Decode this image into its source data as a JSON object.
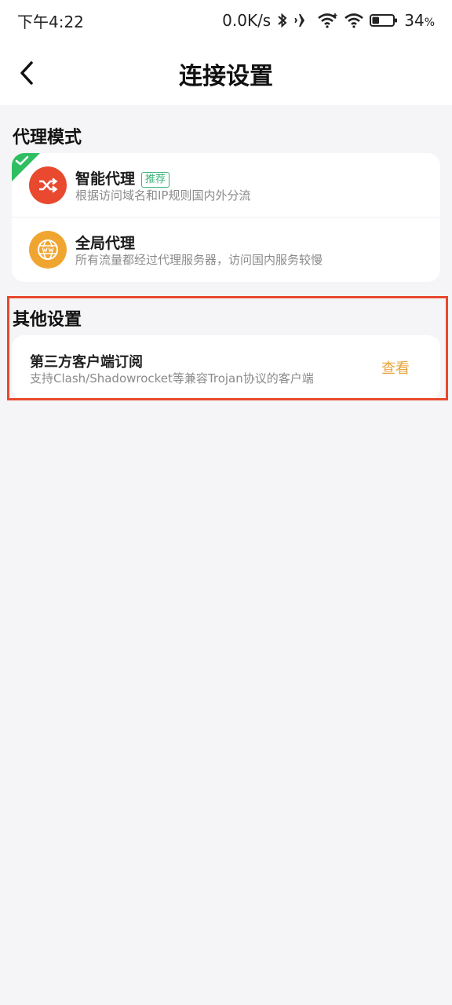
{
  "status_bar": {
    "time": "下午4:22",
    "net_speed": "0.0K/s",
    "battery": "34",
    "battery_unit": "%",
    "battery_level": 0.34,
    "icons": [
      "bluetooth-icon",
      "airplane-mode-icon",
      "wifi-icon",
      "wifi-icon",
      "battery-icon"
    ]
  },
  "header": {
    "title": "连接设置",
    "back_icon": "chevron-left-icon"
  },
  "proxy_mode": {
    "section_title": "代理模式",
    "selected_index": 0,
    "options": [
      {
        "name": "智能代理",
        "badge": "推荐",
        "desc": "根据访问域名和IP规则国内外分流",
        "icon": "shuffle-icon",
        "icon_color": "#e8492f"
      },
      {
        "name": "全局代理",
        "desc": "所有流量都经过代理服务器，访问国内服务较慢",
        "icon": "globe-www-icon",
        "icon_color": "#f0a531"
      }
    ]
  },
  "other_settings": {
    "section_title": "其他设置",
    "item_title": "第三方客户端订阅",
    "item_desc": "支持Clash/Shadowrocket等兼容Trojan协议的客户端",
    "action_label": "查看"
  },
  "colors": {
    "accent_orange": "#e7a43a",
    "check_green": "#2fbf62",
    "badge_green": "#3cb37a",
    "highlight_red": "#e8492f",
    "background": "#f5f5f7"
  }
}
